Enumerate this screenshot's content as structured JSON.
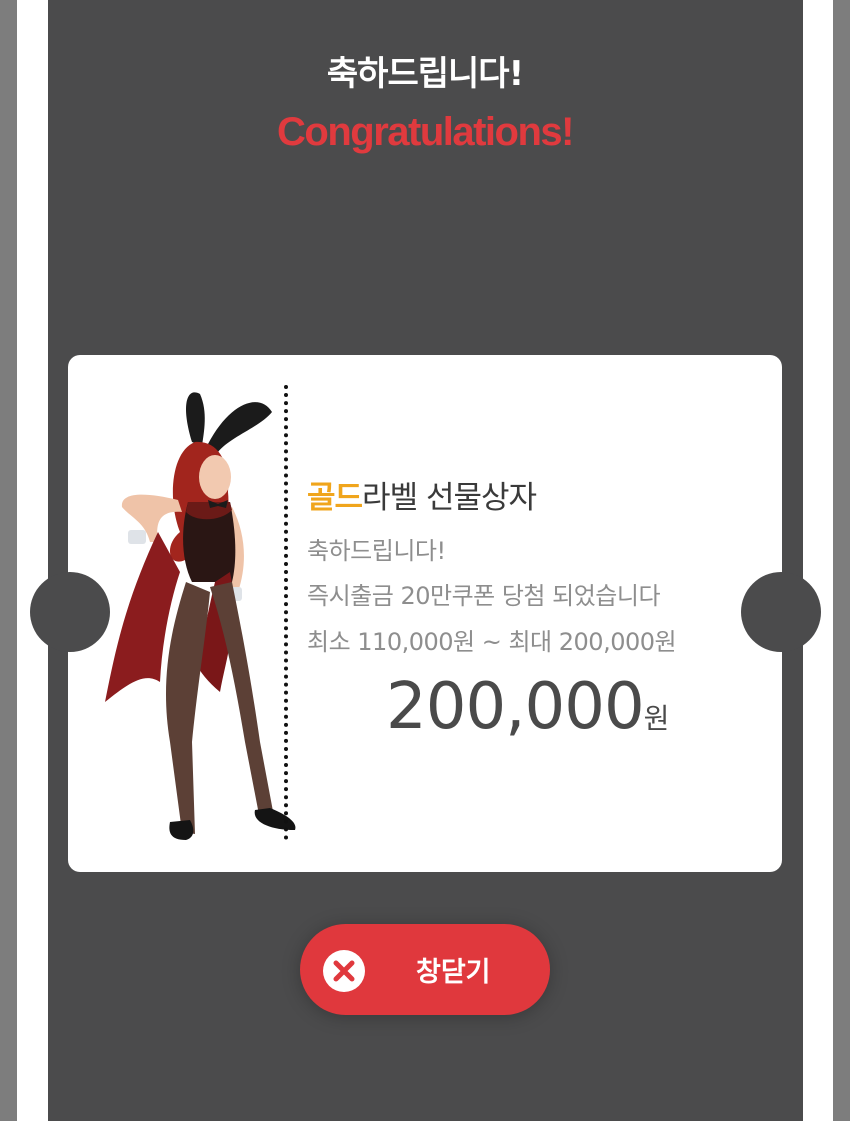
{
  "popup": {
    "title_ko": "축하드립니다!",
    "title_en": "Congratulations!"
  },
  "gift": {
    "label_highlight": "골드",
    "label_rest": "라벨 선물상자",
    "line1": "축하드립니다!",
    "line2": "즉시출금 20만쿠폰 당첨 되었습니다",
    "line3": "최소 110,000원 ~ 최대 200,000원",
    "amount": "200,000",
    "amount_unit": "원"
  },
  "close_button": {
    "label": "창닫기",
    "icon": "close-icon"
  },
  "colors": {
    "panel": "#4b4b4c",
    "accent_red": "#e03a3e",
    "gold": "#f0a51c"
  }
}
